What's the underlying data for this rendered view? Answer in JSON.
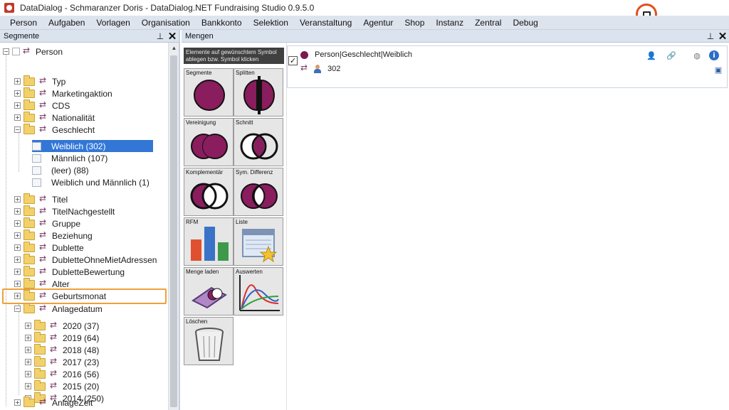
{
  "window": {
    "title": "DataDialog - Schmaranzer Doris - DataDialog.NET Fundraising Studio 0.9.5.0"
  },
  "menu": [
    "Person",
    "Aufgaben",
    "Vorlagen",
    "Organisation",
    "Bankkonto",
    "Selektion",
    "Veranstaltung",
    "Agentur",
    "Shop",
    "Instanz",
    "Zentral",
    "Debug"
  ],
  "left_panel": {
    "title": "Segmente",
    "root": "Person",
    "items": [
      "Typ",
      "Marketingaktion",
      "CDS",
      "Nationalität",
      "Geschlecht"
    ],
    "geschlecht_values": [
      "Weiblich (302)",
      "Männlich (107)",
      "(leer) (88)",
      "Weiblich und Männlich (1)"
    ],
    "items_after": [
      "Titel",
      "TitelNachgestellt",
      "Gruppe",
      "Beziehung",
      "Dublette",
      "DubletteOhneMietAdressen",
      "DubletteBewertung",
      "Alter",
      "Geburtsmonat",
      "Anlagedatum"
    ],
    "anlagedatum_years": [
      "2020 (37)",
      "2019 (64)",
      "2018 (48)",
      "2017 (23)",
      "2016 (56)",
      "2015 (20)",
      "2014 (250)"
    ],
    "last_item": "AnlageZeit"
  },
  "right_panel": {
    "title": "Mengen",
    "hint": "Elemente auf gewünschtem Symbol ablegen bzw. Symbol klicken",
    "tools": [
      "Segmente",
      "Splitten",
      "Vereinigung",
      "Schnitt",
      "Komplementär",
      "Sym. Differenz",
      "RFM",
      "Liste",
      "Menge laden",
      "Auswerten",
      "Löschen"
    ],
    "set": {
      "name": "Person|Geschlecht|Weiblich",
      "count": "302"
    }
  },
  "colors": {
    "accent": "#3277d6",
    "set_purple": "#7a1a50",
    "highlight": "#f0a03c",
    "monitor_ring": "#e0501f"
  }
}
